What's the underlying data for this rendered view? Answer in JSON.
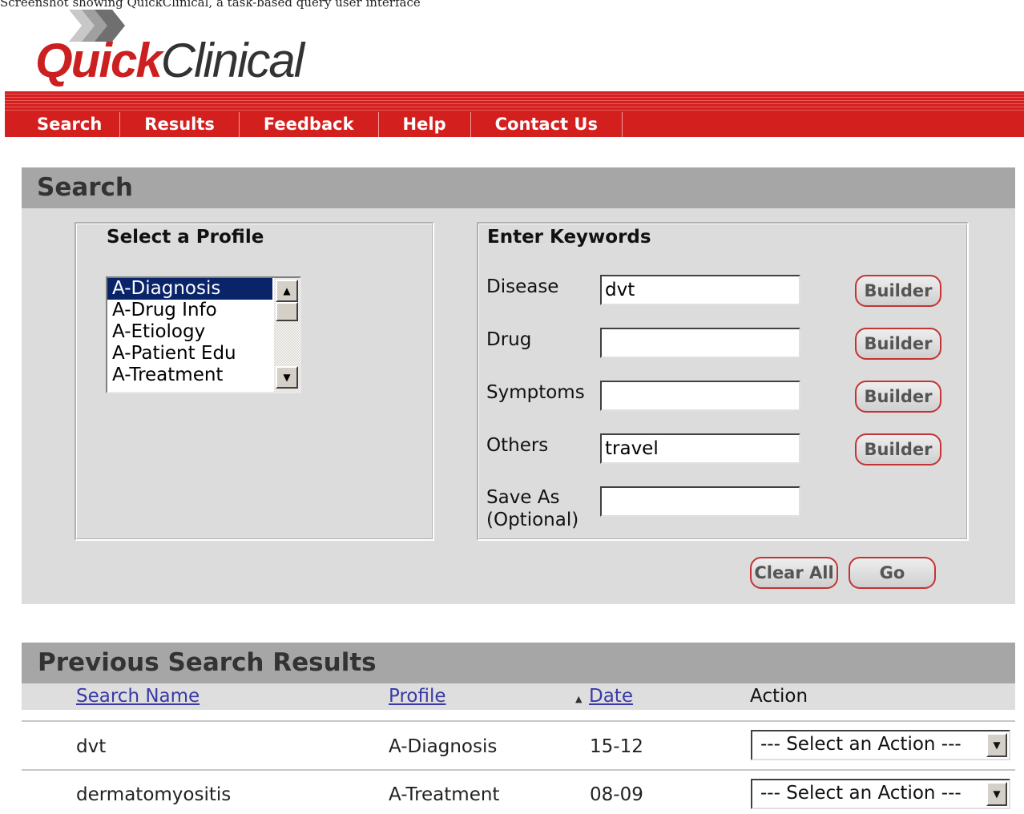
{
  "caption": "Screenshot showing QuickClinical, a task-based query user interface",
  "logo": {
    "quick": "Quick",
    "clinical": "Clinical"
  },
  "nav": {
    "items": [
      "Search",
      "Results",
      "Feedback",
      "Help",
      "Contact Us"
    ]
  },
  "search": {
    "heading": "Search",
    "profile": {
      "title": "Select a Profile",
      "options": [
        "A-Diagnosis",
        "A-Drug Info",
        "A-Etiology",
        "A-Patient Edu",
        "A-Treatment"
      ],
      "selected": "A-Diagnosis"
    },
    "keywords": {
      "title": "Enter Keywords",
      "disease_label": "Disease",
      "disease_value": "dvt",
      "drug_label": "Drug",
      "drug_value": "",
      "symptoms_label": "Symptoms",
      "symptoms_value": "",
      "others_label": "Others",
      "others_value": "travel",
      "saveas_label_1": "Save As",
      "saveas_label_2": "(Optional)",
      "saveas_value": "",
      "builder_label": "Builder"
    },
    "clear_label": "Clear All",
    "go_label": "Go"
  },
  "results": {
    "heading": "Previous Search Results",
    "columns": {
      "name": "Search Name",
      "profile": "Profile",
      "date": "Date",
      "action": "Action"
    },
    "rows": [
      {
        "name": "dvt",
        "profile": "A-Diagnosis",
        "date": "15-12",
        "action": "--- Select an Action ---"
      },
      {
        "name": "dermatomyositis",
        "profile": "A-Treatment",
        "date": "08-09",
        "action": "--- Select an Action ---"
      }
    ]
  },
  "colors": {
    "brand_red": "#d41f1f",
    "panel_header": "#a6a6a6",
    "panel_body": "#dcdcdc",
    "link": "#3a3aa6",
    "selection": "#0a246a"
  },
  "icons": [
    "chevrons-logo-icon",
    "scroll-up-icon",
    "scroll-down-icon",
    "dropdown-arrow-icon",
    "sort-ascending-icon"
  ]
}
